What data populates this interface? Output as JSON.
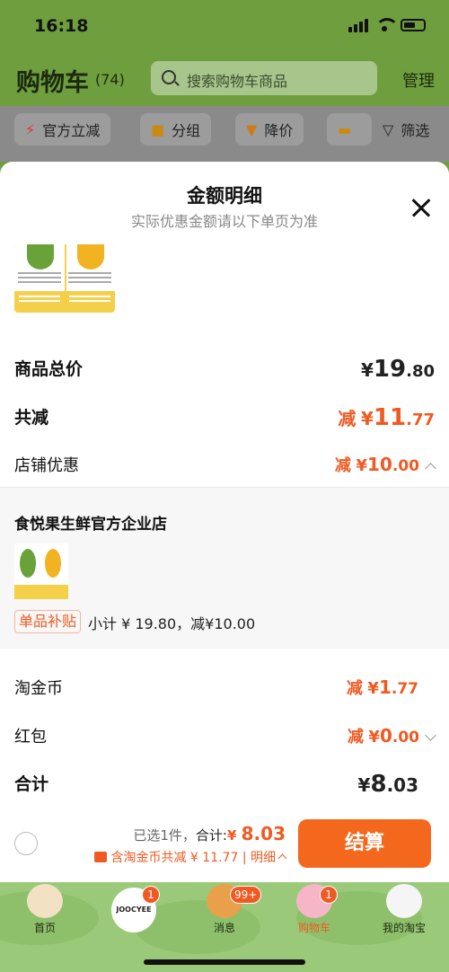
{
  "status": {
    "time": "16:18"
  },
  "header": {
    "title": "购物车",
    "count": "(74)",
    "search_placeholder": "搜索购物车商品",
    "manage_label": "管理"
  },
  "filters": [
    {
      "label": "官方立减",
      "icon": "lightning-icon"
    },
    {
      "label": "分组",
      "icon": "folder-icon"
    },
    {
      "label": "降价",
      "icon": "price-drop-icon"
    },
    {
      "label": "",
      "icon": "cart-icon"
    },
    {
      "label": "筛选",
      "icon": "filter-icon"
    }
  ],
  "sheet": {
    "title": "金额明细",
    "subtitle": "实际优惠金额请以下单页为准",
    "rows": {
      "goods_total": {
        "label": "商品总价",
        "currency": "¥",
        "int": "19",
        "dec": ".80"
      },
      "total_reduce": {
        "label": "共减",
        "prefix": "减",
        "currency": "¥",
        "int": "11",
        "dec": ".77"
      },
      "store_discount": {
        "label": "店铺优惠",
        "prefix": "减",
        "currency": "¥",
        "int": "10",
        "dec": ".00"
      },
      "taojinbi": {
        "label": "淘金币",
        "prefix": "减",
        "currency": "¥",
        "int": "1",
        "dec": ".77"
      },
      "hongbao": {
        "label": "红包",
        "prefix": "减",
        "currency": "¥",
        "int": "0",
        "dec": ".00"
      },
      "sum": {
        "label": "合计",
        "currency": "¥",
        "int": "8",
        "dec": ".03"
      }
    },
    "shop": {
      "name": "食悦果生鲜官方企业店",
      "subsidy_badge": "单品补贴",
      "subtotal_text": "小计 ¥ 19.80，减¥10.00"
    }
  },
  "footer": {
    "selected_text": "已选1件，",
    "total_label": "合计:",
    "total_currency": "¥",
    "total_value": "8.03",
    "coin_text": "含淘金币共减 ¥ 11.77 | 明细",
    "checkout_label": "结算"
  },
  "tabbar": [
    {
      "label": "首页"
    },
    {
      "label": "JOOCYEE",
      "badge": "1"
    },
    {
      "label": "消息",
      "badge": "99+"
    },
    {
      "label": "购物车",
      "badge": "1"
    },
    {
      "label": "我的淘宝"
    }
  ],
  "colors": {
    "accent_orange": "#f05a22",
    "checkout_bg": "#f4681e",
    "header_green": "#6f9e3e"
  }
}
